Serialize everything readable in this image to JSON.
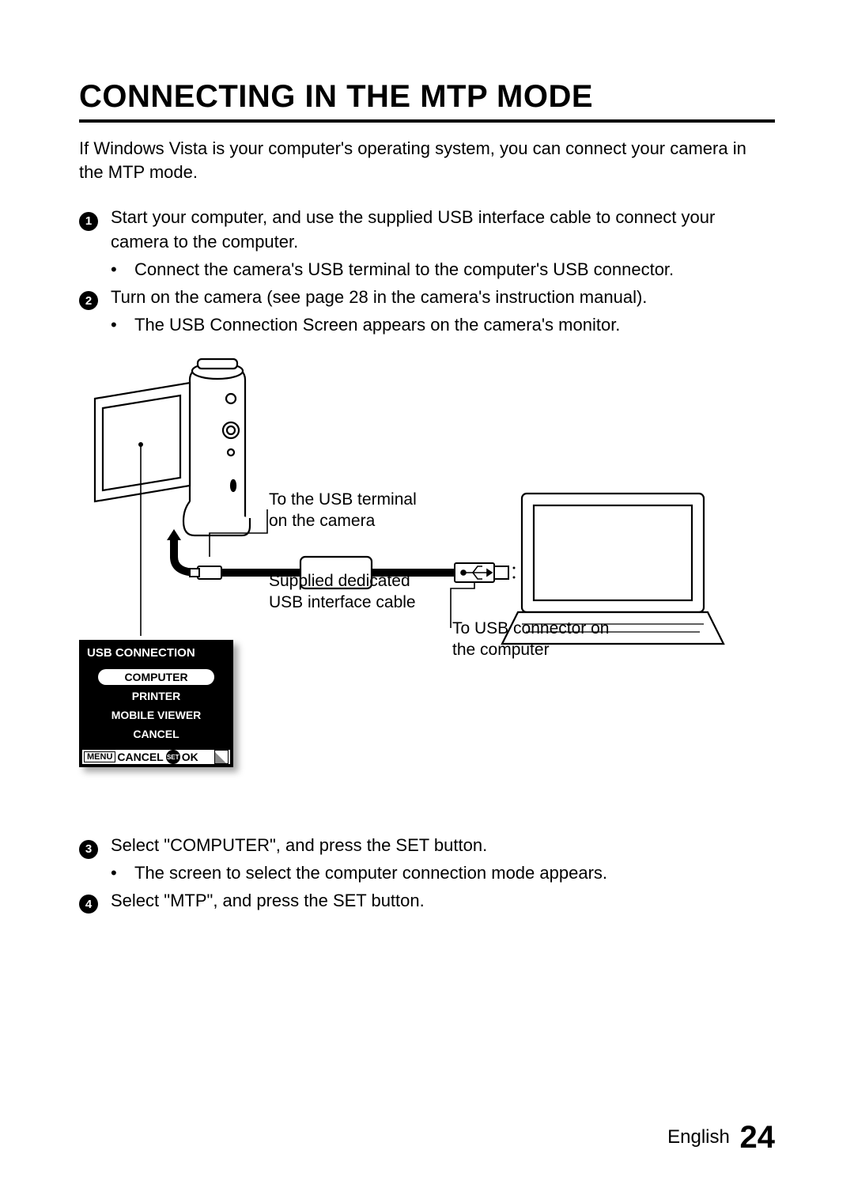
{
  "title": "CONNECTING IN THE MTP MODE",
  "intro": "If Windows Vista is your computer's operating system, you can connect your camera in the MTP mode.",
  "steps": {
    "s1": {
      "num": "1",
      "text": "Start your computer, and use the supplied USB interface cable to connect your camera to the computer.",
      "sub": "Connect the camera's USB terminal to the computer's USB connector."
    },
    "s2": {
      "num": "2",
      "text": "Turn on the camera (see page 28 in the camera's instruction manual).",
      "sub": "The USB Connection Screen appears on the camera's monitor."
    },
    "s3": {
      "num": "3",
      "text": "Select \"COMPUTER\", and press the SET button.",
      "sub": "The screen to select the computer connection mode appears."
    },
    "s4": {
      "num": "4",
      "text": "Select \"MTP\", and press the SET button."
    }
  },
  "diagram": {
    "label_usb_camera": "To the USB terminal on the camera",
    "label_cable": "Supplied dedicated USB interface cable",
    "label_usb_computer": "To USB connector on the computer"
  },
  "menu": {
    "header": "USB CONNECTION",
    "items": {
      "computer": "COMPUTER",
      "printer": "PRINTER",
      "mobile_viewer": "MOBILE VIEWER",
      "cancel": "CANCEL"
    },
    "footer": {
      "menu_btn": "MENU",
      "cancel": "CANCEL",
      "set_btn": "SET",
      "ok": "OK"
    }
  },
  "footer": {
    "lang": "English",
    "page": "24"
  }
}
